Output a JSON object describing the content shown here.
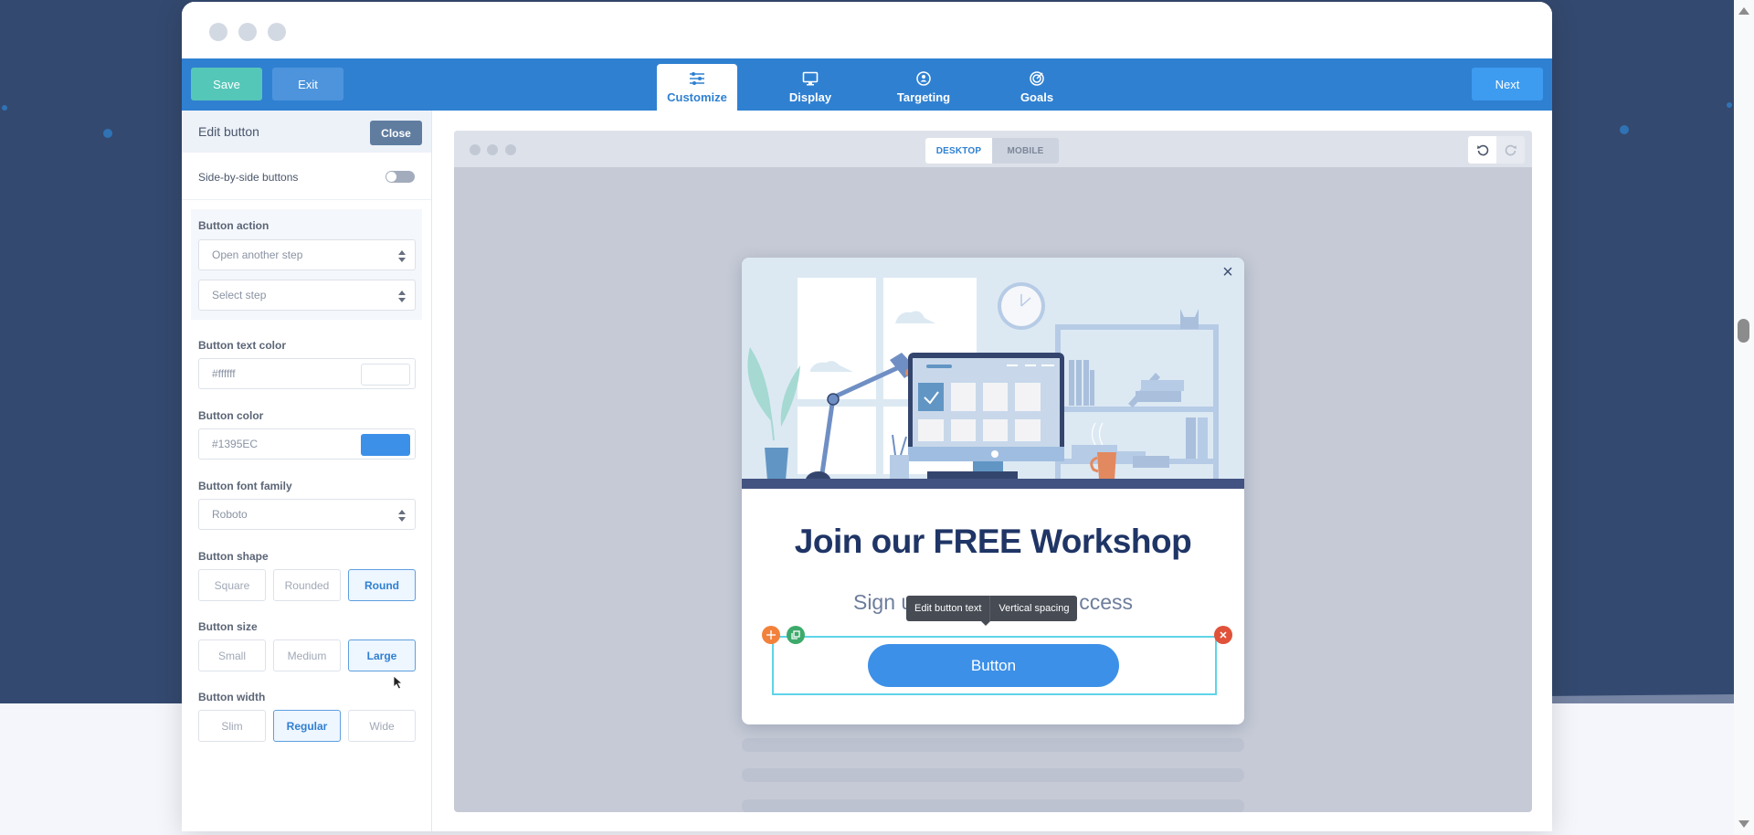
{
  "toolbar": {
    "save_label": "Save",
    "exit_label": "Exit",
    "next_label": "Next",
    "tabs": [
      {
        "label": "Customize",
        "icon": "sliders-icon",
        "active": true
      },
      {
        "label": "Display",
        "icon": "monitor-icon",
        "active": false
      },
      {
        "label": "Targeting",
        "icon": "target-user-icon",
        "active": false
      },
      {
        "label": "Goals",
        "icon": "goal-icon",
        "active": false
      }
    ]
  },
  "panel": {
    "title": "Edit button",
    "close_label": "Close",
    "side_by_side": {
      "label": "Side-by-side buttons",
      "enabled": false
    },
    "button_action": {
      "label": "Button action",
      "action_value": "Open another step",
      "step_placeholder": "Select step"
    },
    "text_color": {
      "label": "Button text color",
      "value": "#ffffff",
      "swatch": "#ffffff"
    },
    "button_color": {
      "label": "Button color",
      "value": "#1395EC",
      "swatch": "#3d90e8"
    },
    "font_family": {
      "label": "Button font family",
      "value": "Roboto"
    },
    "shape": {
      "label": "Button shape",
      "options": [
        "Square",
        "Rounded",
        "Round"
      ],
      "selected": "Round"
    },
    "size": {
      "label": "Button size",
      "options": [
        "Small",
        "Medium",
        "Large"
      ],
      "selected": "Large"
    },
    "width": {
      "label": "Button width",
      "options": [
        "Slim",
        "Regular",
        "Wide"
      ],
      "selected": "Regular"
    }
  },
  "canvas": {
    "device_tabs": [
      "DESKTOP",
      "MOBILE"
    ],
    "active_device": "DESKTOP",
    "popup": {
      "headline": "Join our FREE Workshop",
      "subline_visible_parts": [
        "Sign u",
        "ccess"
      ],
      "button_label": "Button",
      "tooltip_actions": [
        "Edit button text",
        "Vertical spacing"
      ]
    }
  }
}
